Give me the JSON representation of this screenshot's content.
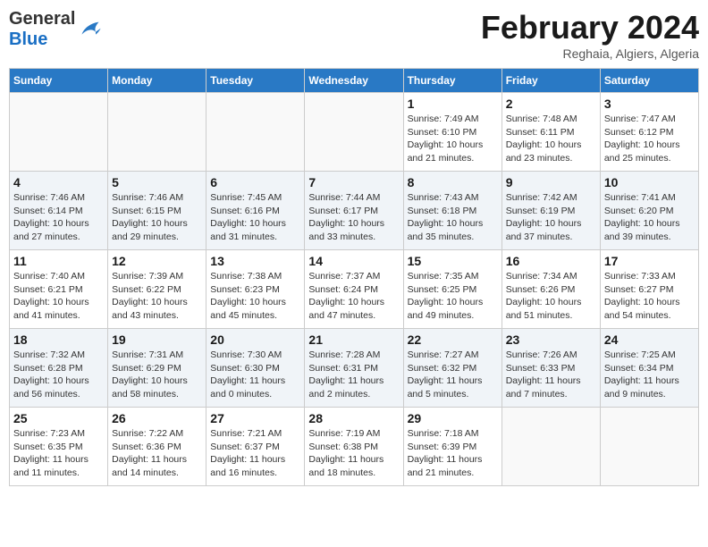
{
  "header": {
    "logo_general": "General",
    "logo_blue": "Blue",
    "month_title": "February 2024",
    "subtitle": "Reghaia, Algiers, Algeria"
  },
  "days_of_week": [
    "Sunday",
    "Monday",
    "Tuesday",
    "Wednesday",
    "Thursday",
    "Friday",
    "Saturday"
  ],
  "weeks": [
    [
      {
        "day": "",
        "info": ""
      },
      {
        "day": "",
        "info": ""
      },
      {
        "day": "",
        "info": ""
      },
      {
        "day": "",
        "info": ""
      },
      {
        "day": "1",
        "info": "Sunrise: 7:49 AM\nSunset: 6:10 PM\nDaylight: 10 hours and 21 minutes."
      },
      {
        "day": "2",
        "info": "Sunrise: 7:48 AM\nSunset: 6:11 PM\nDaylight: 10 hours and 23 minutes."
      },
      {
        "day": "3",
        "info": "Sunrise: 7:47 AM\nSunset: 6:12 PM\nDaylight: 10 hours and 25 minutes."
      }
    ],
    [
      {
        "day": "4",
        "info": "Sunrise: 7:46 AM\nSunset: 6:14 PM\nDaylight: 10 hours and 27 minutes."
      },
      {
        "day": "5",
        "info": "Sunrise: 7:46 AM\nSunset: 6:15 PM\nDaylight: 10 hours and 29 minutes."
      },
      {
        "day": "6",
        "info": "Sunrise: 7:45 AM\nSunset: 6:16 PM\nDaylight: 10 hours and 31 minutes."
      },
      {
        "day": "7",
        "info": "Sunrise: 7:44 AM\nSunset: 6:17 PM\nDaylight: 10 hours and 33 minutes."
      },
      {
        "day": "8",
        "info": "Sunrise: 7:43 AM\nSunset: 6:18 PM\nDaylight: 10 hours and 35 minutes."
      },
      {
        "day": "9",
        "info": "Sunrise: 7:42 AM\nSunset: 6:19 PM\nDaylight: 10 hours and 37 minutes."
      },
      {
        "day": "10",
        "info": "Sunrise: 7:41 AM\nSunset: 6:20 PM\nDaylight: 10 hours and 39 minutes."
      }
    ],
    [
      {
        "day": "11",
        "info": "Sunrise: 7:40 AM\nSunset: 6:21 PM\nDaylight: 10 hours and 41 minutes."
      },
      {
        "day": "12",
        "info": "Sunrise: 7:39 AM\nSunset: 6:22 PM\nDaylight: 10 hours and 43 minutes."
      },
      {
        "day": "13",
        "info": "Sunrise: 7:38 AM\nSunset: 6:23 PM\nDaylight: 10 hours and 45 minutes."
      },
      {
        "day": "14",
        "info": "Sunrise: 7:37 AM\nSunset: 6:24 PM\nDaylight: 10 hours and 47 minutes."
      },
      {
        "day": "15",
        "info": "Sunrise: 7:35 AM\nSunset: 6:25 PM\nDaylight: 10 hours and 49 minutes."
      },
      {
        "day": "16",
        "info": "Sunrise: 7:34 AM\nSunset: 6:26 PM\nDaylight: 10 hours and 51 minutes."
      },
      {
        "day": "17",
        "info": "Sunrise: 7:33 AM\nSunset: 6:27 PM\nDaylight: 10 hours and 54 minutes."
      }
    ],
    [
      {
        "day": "18",
        "info": "Sunrise: 7:32 AM\nSunset: 6:28 PM\nDaylight: 10 hours and 56 minutes."
      },
      {
        "day": "19",
        "info": "Sunrise: 7:31 AM\nSunset: 6:29 PM\nDaylight: 10 hours and 58 minutes."
      },
      {
        "day": "20",
        "info": "Sunrise: 7:30 AM\nSunset: 6:30 PM\nDaylight: 11 hours and 0 minutes."
      },
      {
        "day": "21",
        "info": "Sunrise: 7:28 AM\nSunset: 6:31 PM\nDaylight: 11 hours and 2 minutes."
      },
      {
        "day": "22",
        "info": "Sunrise: 7:27 AM\nSunset: 6:32 PM\nDaylight: 11 hours and 5 minutes."
      },
      {
        "day": "23",
        "info": "Sunrise: 7:26 AM\nSunset: 6:33 PM\nDaylight: 11 hours and 7 minutes."
      },
      {
        "day": "24",
        "info": "Sunrise: 7:25 AM\nSunset: 6:34 PM\nDaylight: 11 hours and 9 minutes."
      }
    ],
    [
      {
        "day": "25",
        "info": "Sunrise: 7:23 AM\nSunset: 6:35 PM\nDaylight: 11 hours and 11 minutes."
      },
      {
        "day": "26",
        "info": "Sunrise: 7:22 AM\nSunset: 6:36 PM\nDaylight: 11 hours and 14 minutes."
      },
      {
        "day": "27",
        "info": "Sunrise: 7:21 AM\nSunset: 6:37 PM\nDaylight: 11 hours and 16 minutes."
      },
      {
        "day": "28",
        "info": "Sunrise: 7:19 AM\nSunset: 6:38 PM\nDaylight: 11 hours and 18 minutes."
      },
      {
        "day": "29",
        "info": "Sunrise: 7:18 AM\nSunset: 6:39 PM\nDaylight: 11 hours and 21 minutes."
      },
      {
        "day": "",
        "info": ""
      },
      {
        "day": "",
        "info": ""
      }
    ]
  ]
}
